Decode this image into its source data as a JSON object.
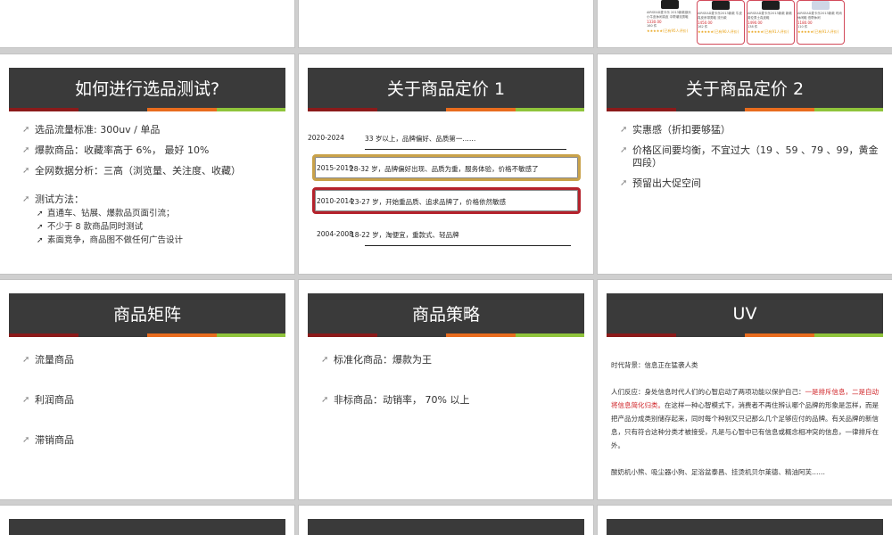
{
  "slides": {
    "test": {
      "title": "如何进行选品测试?",
      "bullets": [
        "选品流量标准:  300uv  / 单品",
        "爆款商品：收藏率高于 6%，  最好 10%",
        "全网数据分析：三高（浏览量、关注度、收藏）"
      ],
      "method_title": "测试方法：",
      "method_items": [
        "直通车、钻展、爆款品页面引流；",
        "不少于 8 款商品同时测试",
        "素面竞争，商品图不做任何广告设计"
      ]
    },
    "pricing1": {
      "title": "关于商品定价 1",
      "rows": [
        {
          "year": "2020-2024",
          "text": "33 岁以上，品牌偏好、品质第一……"
        },
        {
          "year": "2015-2019",
          "text": "28-32 岁，品牌偏好出现、品质为重，服务体验，价格不敏感了"
        },
        {
          "year": "2010-2014",
          "text": "23-27 岁，开始重品质、追求品牌了，价格依然敏感"
        },
        {
          "year": "2004-2008",
          "text": "18-22 岁，淘便宜，重款式、轻品牌"
        }
      ]
    },
    "pricing2": {
      "title": "关于商品定价 2",
      "bullets": [
        "实惠感（折扣要够猛）",
        "价格区间要均衡，不宜过大（19 、59 、79 、99，黄金四段）",
        "预留出大促空间"
      ]
    },
    "matrix": {
      "title": "商品矩阵",
      "bullets": [
        "流量商品",
        "利润商品",
        "滞销商品"
      ]
    },
    "strategy": {
      "title": "商品策略",
      "bullets": [
        "标准化商品：爆款为王",
        "非标商品：动销率，  70% 以上"
      ]
    },
    "uv": {
      "title": "UV",
      "bg": "时代背景：信息正在猛袭人类",
      "reaction_prefix": "人们反应：身处信息时代人们的心智启动了两项功能以保护自己：",
      "reaction_red": "一是排斥信息，二是自动将信息简化归类。",
      "reaction_rest": "在这样一种心智模式下，消费者不再住辨认哪个品牌的形象是怎样，而是把产品分成类别储存起来，同时每个种别又只记那么几个足够应付的品牌。有关品牌的新信息，只有符合这种分类才被接受，凡是与心智中已有信息或概念相冲突的信息，一律排斥在外。",
      "examples": "酸奶机小熊、吸尘器小狗、足浴盆泰昌、挂烫机贝尔莱德、精油阿芙……"
    },
    "products": [
      {
        "desc": "AIRSEAD麦卡乐 2013新款钢头 小牛皮休闲真皮 中帮潮流男鞋",
        "price": "1330.00",
        "sold": "160 件",
        "reviews": "(已有95人评价)"
      },
      {
        "desc": "AIRSEAD麦卡乐2013新款 牛皮 真皮系带男鞋 流行款",
        "price": "1450.00",
        "sold": "162 件",
        "reviews": "(已有90人评价)"
      },
      {
        "desc": "AIRSEAD麦卡乐2013新款 新款英伦男士真皮鞋",
        "price": "1490.00",
        "sold": "138 件",
        "reviews": "(已有91人评价)"
      },
      {
        "desc": "AIRSEAD麦卡乐2013新款 时尚休闲鞋 低帮休闲",
        "price": "1180.00",
        "sold": "110 件",
        "reviews": "(已有91人评价)"
      }
    ]
  }
}
